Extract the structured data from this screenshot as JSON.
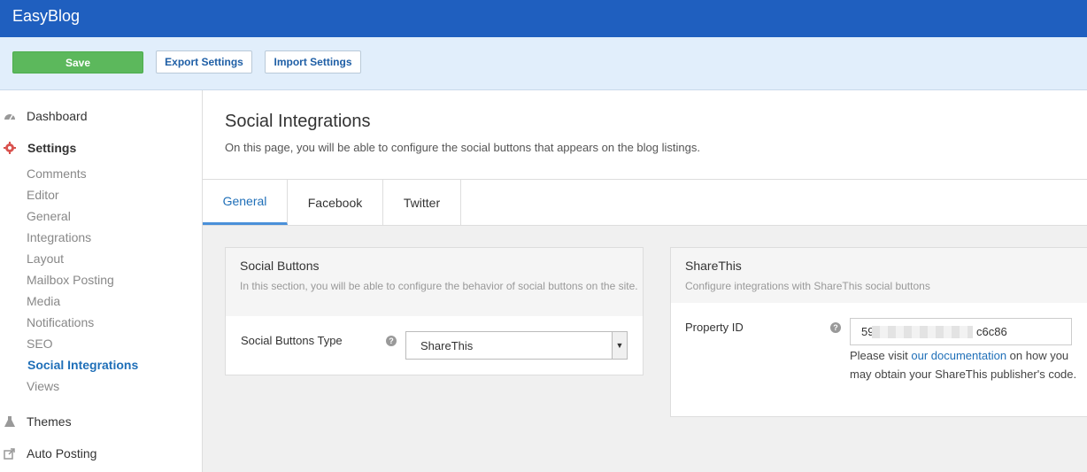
{
  "app": {
    "brand": "EasyBlog"
  },
  "toolbar": {
    "save_label": "Save",
    "export_label": "Export Settings",
    "import_label": "Import Settings"
  },
  "sidebar": {
    "dashboard": "Dashboard",
    "settings": "Settings",
    "sub_items": [
      "Comments",
      "Editor",
      "General",
      "Integrations",
      "Layout",
      "Mailbox Posting",
      "Media",
      "Notifications",
      "SEO",
      "Social Integrations",
      "Views"
    ],
    "active_item": "Social Integrations",
    "themes": "Themes",
    "auto_posting": "Auto Posting"
  },
  "page": {
    "title": "Social Integrations",
    "description": "On this page, you will be able to configure the social buttons that appears on the blog listings."
  },
  "tabs": [
    "General",
    "Facebook",
    "Twitter"
  ],
  "active_tab": "General",
  "social_buttons": {
    "title": "Social Buttons",
    "description": "In this section, you will be able to configure the behavior of social buttons on the site.",
    "field_label": "Social Buttons Type",
    "selected_value": "ShareThis"
  },
  "sharethis": {
    "title": "ShareThis",
    "description": "Configure integrations with ShareThis social buttons",
    "field_label": "Property ID",
    "property_id_prefix": "59b",
    "property_id_suffix": "c6c86",
    "note_before": "Please visit ",
    "note_link": "our documentation",
    "note_after": " on how you may obtain your ShareThis publisher's code."
  },
  "colors": {
    "topbar": "#1f5fbf",
    "toolbar": "#e1eefb",
    "save": "#5cb85c",
    "link": "#1f6fb8"
  },
  "icons": {
    "dashboard": "dashboard-icon",
    "settings": "gear-icon",
    "themes": "flask-icon",
    "auto_posting": "share-icon",
    "help": "question-icon",
    "dropdown": "chevron-down-icon"
  }
}
